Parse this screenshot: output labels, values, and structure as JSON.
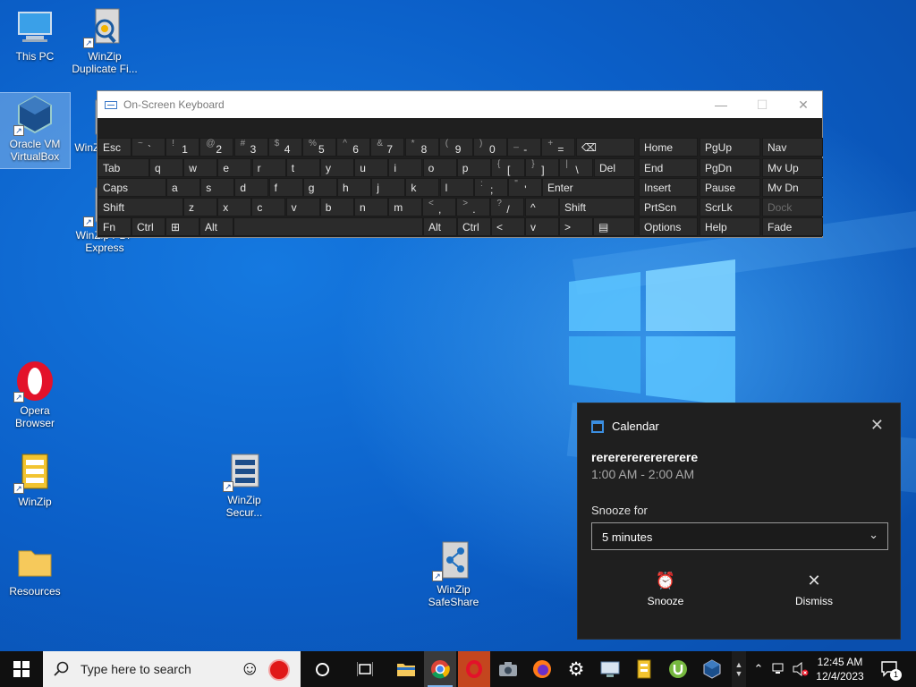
{
  "desktop": {
    "icons": [
      {
        "label": "This PC"
      },
      {
        "label": "WinZip Duplicate Fi..."
      },
      {
        "label": "Oracle VM VirtualBox"
      },
      {
        "label": "WinZip Ma..."
      },
      {
        "label": "WinZip PDF Express"
      },
      {
        "label": "Opera Browser"
      },
      {
        "label": "WinZip"
      },
      {
        "label": "WinZip Secur..."
      },
      {
        "label": "Resources"
      },
      {
        "label": "WinZip SafeShare"
      }
    ]
  },
  "osk": {
    "title": "On-Screen Keyboard",
    "minimize": "—",
    "maximize": "☐",
    "close": "✕",
    "row1": [
      {
        "s": "~",
        "m": "`"
      },
      {
        "s": "!",
        "m": "1"
      },
      {
        "s": "@",
        "m": "2"
      },
      {
        "s": "#",
        "m": "3"
      },
      {
        "s": "$",
        "m": "4"
      },
      {
        "s": "%",
        "m": "5"
      },
      {
        "s": "^",
        "m": "6"
      },
      {
        "s": "&",
        "m": "7"
      },
      {
        "s": "*",
        "m": "8"
      },
      {
        "s": "(",
        "m": "9"
      },
      {
        "s": ")",
        "m": "0"
      },
      {
        "s": "_",
        "m": "-"
      },
      {
        "s": "+",
        "m": "="
      }
    ],
    "esc": "Esc",
    "backspace": "⌫",
    "tab": "Tab",
    "row2": [
      "q",
      "w",
      "e",
      "r",
      "t",
      "y",
      "u",
      "i",
      "o",
      "p"
    ],
    "row2_extra": [
      {
        "s": "{",
        "m": "["
      },
      {
        "s": "}",
        "m": "]"
      },
      {
        "s": "|",
        "m": "\\"
      }
    ],
    "del": "Del",
    "caps": "Caps",
    "row3": [
      "a",
      "s",
      "d",
      "f",
      "g",
      "h",
      "j",
      "k",
      "l"
    ],
    "row3_extra": [
      {
        "s": ":",
        "m": ";"
      },
      {
        "s": "\"",
        "m": "'"
      }
    ],
    "enter": "Enter",
    "shift": "Shift",
    "row4": [
      "z",
      "x",
      "c",
      "v",
      "b",
      "n",
      "m"
    ],
    "row4_extra": [
      {
        "s": "<",
        "m": ","
      },
      {
        "s": ">",
        "m": "."
      },
      {
        "s": "?",
        "m": "/"
      }
    ],
    "up": "^",
    "fn": "Fn",
    "ctrl": "Ctrl",
    "win": "⊞",
    "alt": "Alt",
    "left": "<",
    "down": "v",
    "right": ">",
    "menu": "▤",
    "nav": [
      [
        "Home",
        "PgUp",
        "Nav"
      ],
      [
        "End",
        "PgDn",
        "Mv Up"
      ],
      [
        "Insert",
        "Pause",
        "Mv Dn"
      ],
      [
        "PrtScn",
        "ScrLk",
        "Dock"
      ],
      [
        "Options",
        "Help",
        "Fade"
      ]
    ]
  },
  "toast": {
    "app": "Calendar",
    "close": "✕",
    "title": "rerererererererere",
    "time": "1:00 AM - 2:00 AM",
    "snooze_label": "Snooze for",
    "snooze_value": "5 minutes",
    "snooze_button": "Snooze",
    "dismiss_button": "Dismiss"
  },
  "taskbar": {
    "search_placeholder": "Type here to search",
    "time": "12:45 AM",
    "date": "12/4/2023",
    "notification_count": "1"
  },
  "colors": {
    "accent": "#0a63c9",
    "taskbar": "#101010",
    "toast_bg": "#1f1f1f"
  }
}
